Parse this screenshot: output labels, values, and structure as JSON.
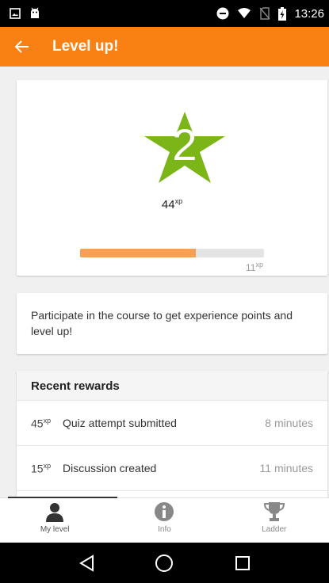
{
  "status_bar": {
    "time": "13:26",
    "icons": [
      "picture-icon",
      "android-icon",
      "do-not-disturb-icon",
      "wifi-icon",
      "no-sim-icon",
      "battery-charging-icon"
    ]
  },
  "app_bar": {
    "title": "Level up!",
    "back_icon": "arrow-back-icon",
    "color": "#f98012"
  },
  "level_card": {
    "level": "2",
    "xp_total": "44",
    "xp_unit": "xp",
    "progress_fraction": 0.63,
    "xp_remaining": "11",
    "star_color": "#7cb518",
    "progress_color": "#f5a053"
  },
  "info_card": {
    "text": "Participate in the course to get experience points and level up!"
  },
  "recent_rewards": {
    "title": "Recent rewards",
    "rows": [
      {
        "xp": "45",
        "unit": "xp",
        "label": "Quiz attempt submitted",
        "time": "8 minutes"
      },
      {
        "xp": "15",
        "unit": "xp",
        "label": "Discussion created",
        "time": "11 minutes"
      }
    ]
  },
  "tabs": [
    {
      "label": "My level",
      "icon": "person-icon",
      "active": true
    },
    {
      "label": "Info",
      "icon": "info-icon",
      "active": false
    },
    {
      "label": "Ladder",
      "icon": "trophy-icon",
      "active": false
    }
  ],
  "nav_bar": {
    "buttons": [
      "back-triangle-icon",
      "home-circle-icon",
      "recents-square-icon"
    ]
  }
}
